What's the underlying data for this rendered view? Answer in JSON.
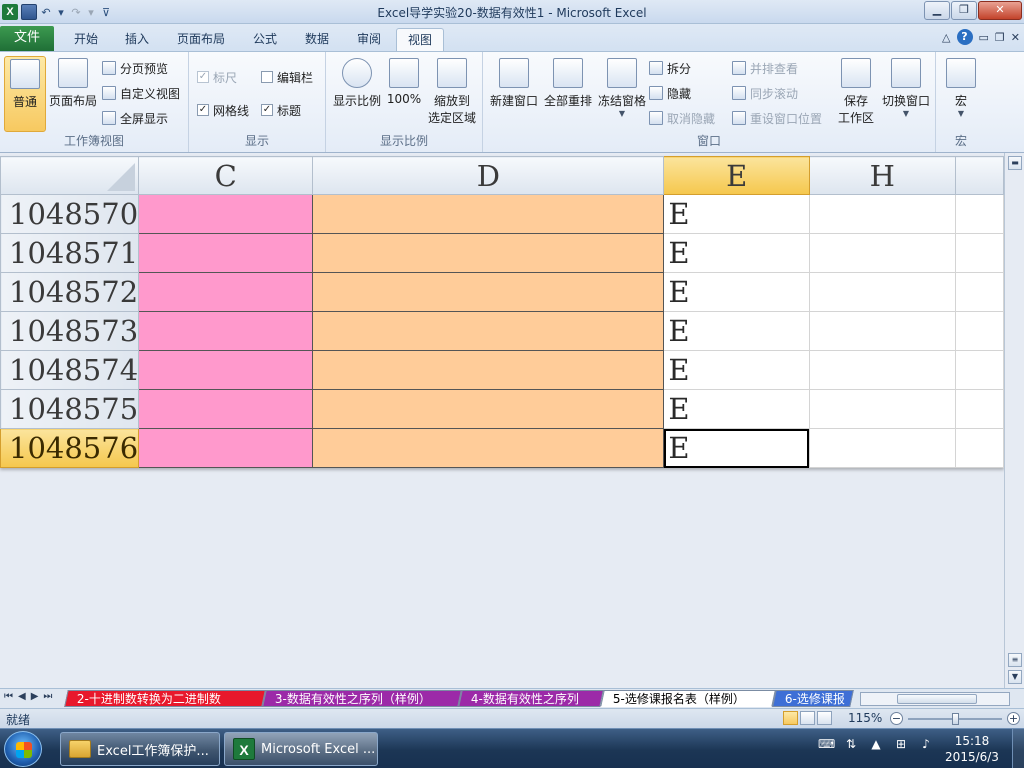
{
  "window": {
    "title": "Excel导学实验20-数据有效性1 - Microsoft Excel",
    "logo_letter": "X"
  },
  "tabs": [
    {
      "label": "文件"
    },
    {
      "label": "开始"
    },
    {
      "label": "插入"
    },
    {
      "label": "页面布局"
    },
    {
      "label": "公式"
    },
    {
      "label": "数据"
    },
    {
      "label": "审阅"
    },
    {
      "label": "视图"
    }
  ],
  "active_tab": "视图",
  "ribbon": {
    "workbook_views": {
      "label": "工作簿视图",
      "normal": "普通",
      "page_layout": "页面布局",
      "page_break": "分页预览",
      "custom_views": "自定义视图",
      "full_screen": "全屏显示"
    },
    "show": {
      "label": "显示",
      "ruler": "标尺",
      "formula_bar": "编辑栏",
      "gridlines": "网格线",
      "headings": "标题"
    },
    "zoom": {
      "label": "显示比例",
      "zoom": "显示比例",
      "hundred": "100%",
      "zoom_selection_1": "缩放到",
      "zoom_selection_2": "选定区域"
    },
    "window": {
      "label": "窗口",
      "new_window": "新建窗口",
      "arrange_all": "全部重排",
      "freeze_panes": "冻结窗格",
      "split": "拆分",
      "hide": "隐藏",
      "unhide": "取消隐藏",
      "side_by_side": "并排查看",
      "sync_scroll": "同步滚动",
      "reset_position": "重设窗口位置",
      "save_workspace_1": "保存",
      "save_workspace_2": "工作区",
      "switch_windows": "切换窗口"
    },
    "macros": {
      "label": "宏",
      "macros": "宏"
    }
  },
  "sheet": {
    "columns": [
      "C",
      "D",
      "E",
      "H"
    ],
    "selected_column": "E",
    "rows": [
      {
        "num": "1048570",
        "e": "E"
      },
      {
        "num": "1048571",
        "e": "E"
      },
      {
        "num": "1048572",
        "e": "E"
      },
      {
        "num": "1048573",
        "e": "E"
      },
      {
        "num": "1048574",
        "e": "E"
      },
      {
        "num": "1048575",
        "e": "E"
      },
      {
        "num": "1048576",
        "e": "E"
      }
    ],
    "selected_row": "1048576",
    "colors": {
      "c_fill": "#ff99cc",
      "d_fill": "#ffcc99"
    }
  },
  "sheet_tabs": [
    {
      "label": "2-十进制数转换为二进制数",
      "color": "#e8182c"
    },
    {
      "label": "3-数据有效性之序列（样例）",
      "color": "#9c2aa8"
    },
    {
      "label": "4-数据有效性之序列",
      "color": "#9c2aa8"
    },
    {
      "label": "5-选修课报名表（样例）",
      "color": "#ffffff"
    },
    {
      "label": "6-选修课报",
      "color": "#3e6fd6"
    }
  ],
  "status": {
    "ready": "就绪",
    "zoom": "115%"
  },
  "taskbar": {
    "items": [
      {
        "label": "Excel工作簿保护..."
      },
      {
        "label": "Microsoft Excel ..."
      }
    ],
    "time": "15:18",
    "date": "2015/6/3"
  }
}
